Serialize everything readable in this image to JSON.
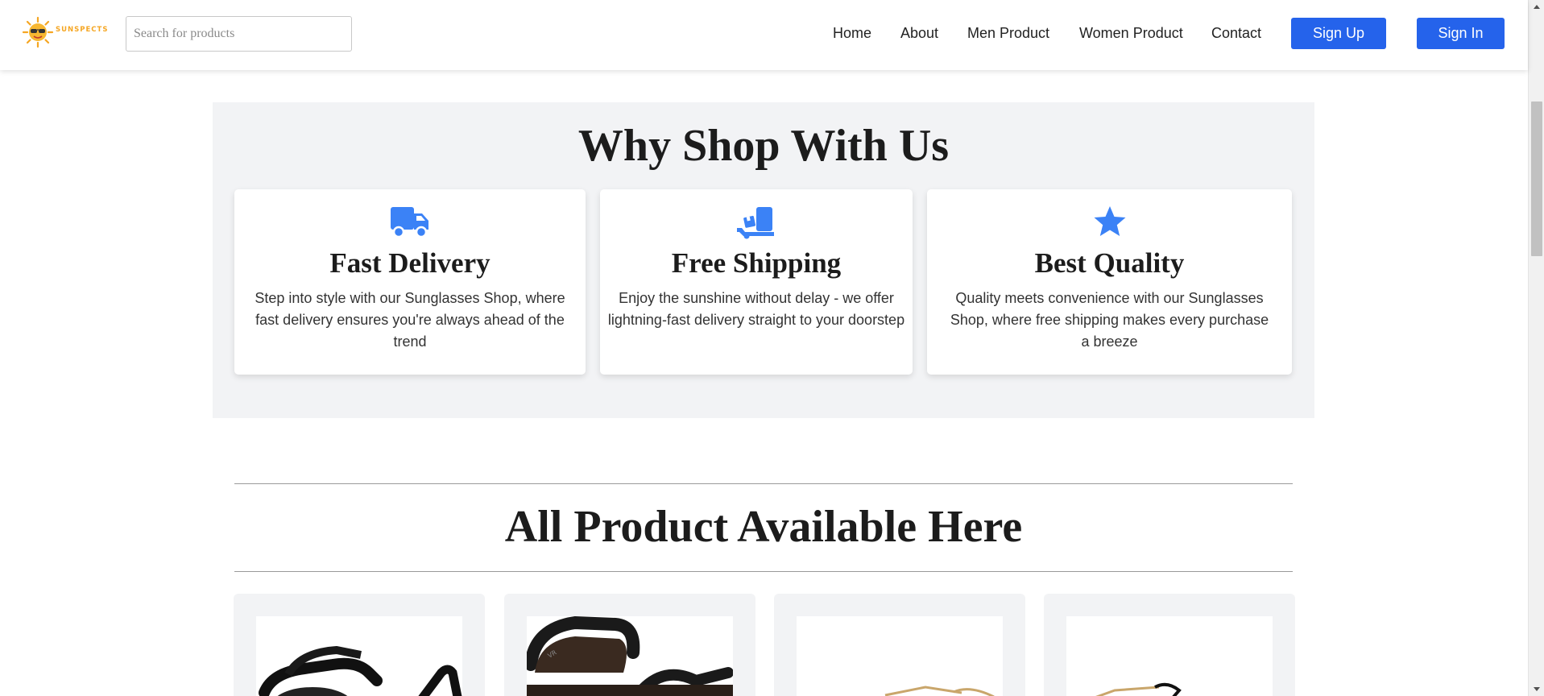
{
  "header": {
    "logo_text": "SUNSPECTS",
    "search_placeholder": "Search for products",
    "nav": [
      "Home",
      "About",
      "Men Product",
      "Women Product",
      "Contact"
    ],
    "signup_label": "Sign Up",
    "signin_label": "Sign In"
  },
  "why": {
    "title": "Why Shop With Us",
    "cards": [
      {
        "icon": "truck-icon",
        "title": "Fast Delivery",
        "text": "Step into style with our Sunglasses Shop, where fast delivery ensures you're always ahead of the trend"
      },
      {
        "icon": "dolly-icon",
        "title": "Free Shipping",
        "text": "Enjoy the sunshine without delay - we offer lightning-fast delivery straight to your doorstep"
      },
      {
        "icon": "star-icon",
        "title": "Best Quality",
        "text": "Quality meets convenience with our Sunglasses Shop, where free shipping makes every purchase a breeze"
      }
    ]
  },
  "products": {
    "title": "All Product Available Here",
    "items": [
      {
        "image": "black-sunglasses-image"
      },
      {
        "image": "brown-sunglasses-image"
      },
      {
        "image": "gold-aviator-image"
      },
      {
        "image": "black-aviator-image"
      }
    ]
  },
  "colors": {
    "accent": "#2563eb",
    "icon_blue": "#3b82f6",
    "section_bg": "#f2f3f5",
    "logo": "#f5a623"
  }
}
